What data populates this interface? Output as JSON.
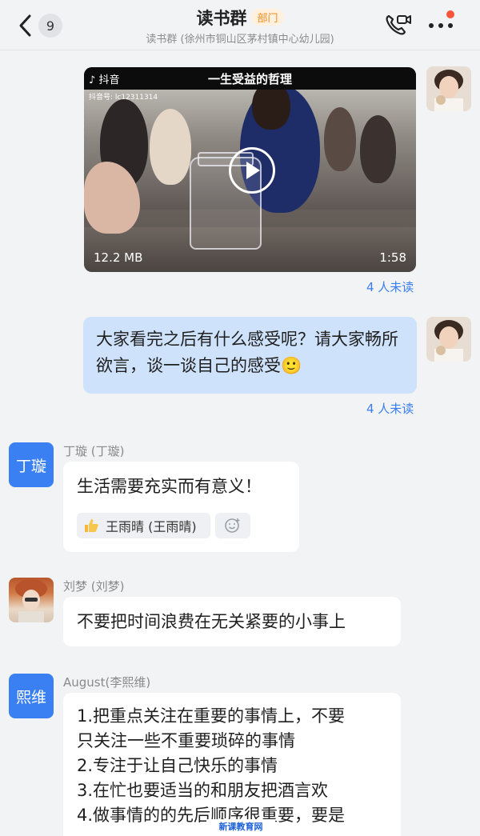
{
  "header": {
    "unread_count": "9",
    "title": "读书群",
    "tag": "部门",
    "subtitle": "读书群 (徐州市铜山区茅村镇中心幼儿园)"
  },
  "video_message": {
    "app_name": "抖音",
    "account_id": "抖音号: lc12311314",
    "video_title": "一生受益的哲理",
    "size": "12.2 MB",
    "duration": "1:58",
    "unread": "4 人未读"
  },
  "text_message_self": {
    "text": "大家看完之后有什么感受呢？请大家畅所欲言，谈一谈自己的感受🙂",
    "unread": "4 人未读"
  },
  "messages": [
    {
      "avatar_text": "丁璇",
      "sender": "丁璇 (丁璇)",
      "text": "生活需要充实而有意义！",
      "reaction_user": "王雨晴 (王雨晴)"
    },
    {
      "sender": "刘梦 (刘梦)",
      "text": "不要把时间浪费在无关紧要的小事上"
    },
    {
      "avatar_text": "熙维",
      "sender": "August(李熙维)",
      "lines": [
        "1.把重点关注在重要的事情上，不要",
        "只关注一些不重要琐碎的事情",
        "2.专注于让自己快乐的事情",
        "3.在忙也要适当的和朋友把酒言欢",
        "4.做事情的的先后顺序很重要，要是"
      ]
    }
  ],
  "watermark": "新课教育网",
  "colors": {
    "accent_blue": "#3a80f3",
    "self_bubble": "#cfe2fb",
    "unread_text": "#3a7ff0",
    "tag_orange": "#f08a1c"
  }
}
